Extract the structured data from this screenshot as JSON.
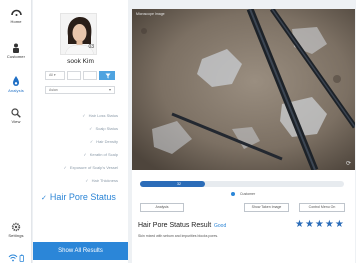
{
  "rail": {
    "items": [
      {
        "label": "Home",
        "icon": "home-icon"
      },
      {
        "label": "Customer",
        "icon": "customer-icon"
      },
      {
        "label": "Analysis",
        "icon": "analysis-icon"
      },
      {
        "label": "View",
        "icon": "search-icon"
      }
    ],
    "settings_label": "Settings",
    "status_icons": [
      "wifi-icon",
      "battery-icon"
    ]
  },
  "profile": {
    "name": "sook Kim",
    "avatar_badge": "03",
    "filter_1": "All ▾",
    "date_select": "Asian"
  },
  "menu": {
    "items": [
      "Hair Loss Status",
      "Scalp Status",
      "Hair Density",
      "Keratin of Scalp",
      "Exposure of Scalp's Vessel",
      "Hair Thickness"
    ],
    "selected": "Hair Pore Status",
    "show_all": "Show All Results"
  },
  "main": {
    "scope_label": "Microscope Image",
    "progress_percent": 32,
    "progress_text": "32",
    "legend_label": "Customer",
    "buttons": [
      "Analysis",
      "Show Taken Image",
      "Control Menu On"
    ]
  },
  "result": {
    "title": "Hair Pore Status Result",
    "grade": "Good",
    "stars": "★★★★★",
    "rating": 5,
    "description": "Skin mixed with sebum and impurities blocks pores."
  },
  "colors": {
    "accent": "#2b86d8",
    "star": "#2b6cb8"
  }
}
